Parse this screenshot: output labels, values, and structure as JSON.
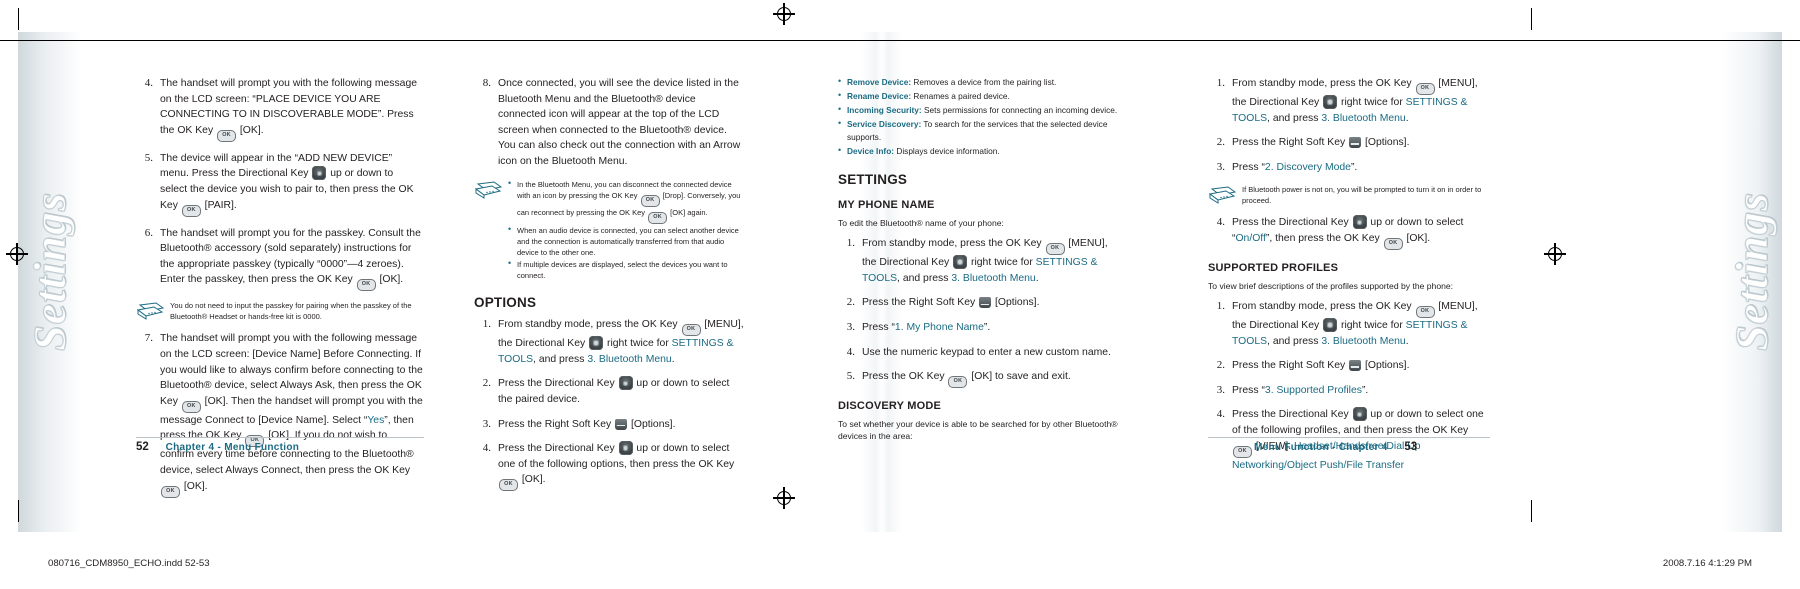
{
  "document": {
    "sidetab_left": "Settings",
    "sidetab_right": "Settings"
  },
  "footer": {
    "left_page_number": "52",
    "left_chapter": "Chapter 4 - Menu Function",
    "right_chapter": "Menu Function - Chapter 4",
    "right_page_number": "53"
  },
  "printbar": {
    "file": "080716_CDM8950_ECHO.indd   52-53",
    "timestamp": "2008.7.16   4:1:29 PM"
  },
  "keys": {
    "ok_label": "OK"
  },
  "column1": {
    "steps": [
      {
        "num": "4",
        "parts": [
          {
            "t": "The handset will prompt you with the following message on the LCD screen: “PLACE DEVICE YOU ARE CONNECTING TO IN DISCOVERABLE MODE”. Press the OK Key "
          },
          {
            "k": "ok"
          },
          {
            "t": " [OK]."
          }
        ]
      },
      {
        "num": "5",
        "parts": [
          {
            "t": "The device will appear in the “ADD NEW DEVICE” menu. Press the Directional Key "
          },
          {
            "k": "dir"
          },
          {
            "t": " up or down to select the device you wish to pair to, then press the OK Key "
          },
          {
            "k": "ok"
          },
          {
            "t": " [PAIR]."
          }
        ]
      },
      {
        "num": "6",
        "parts": [
          {
            "t": "The handset will prompt you for the passkey. Consult the Bluetooth® accessory (sold separately) instructions for the appropriate passkey (typically “0000”—4 zeroes). Enter the passkey, then press the OK Key "
          },
          {
            "k": "ok"
          },
          {
            "t": " [OK]."
          }
        ]
      }
    ],
    "note": "You do not need to input the passkey for pairing when the passkey of the Bluetooth® Headset or hands-free kit is 0000.",
    "step7": {
      "num": "7",
      "parts": [
        {
          "t": "The handset will prompt you with the following message on the LCD screen: [Device Name] Before Connecting. If you would like to always confirm before connecting to the Bluetooth® device, select Always Ask, then press the OK Key "
        },
        {
          "k": "ok"
        },
        {
          "t": " [OK]. Then the handset will prompt you with the message Connect to [Device Name]. Select “"
        },
        {
          "b": "Yes"
        },
        {
          "t": "”, then press the OK Key "
        },
        {
          "k": "ok"
        },
        {
          "t": " [OK]. If you do not wish to confirm every time before connecting to the Bluetooth® device, select Always Connect, then press the OK Key "
        },
        {
          "k": "ok"
        },
        {
          "t": " [OK]."
        }
      ]
    }
  },
  "column2": {
    "step8": {
      "num": "8",
      "text": "Once connected, you will see the device listed in the Bluetooth Menu and the Bluetooth® device connected icon will appear at the top of the LCD screen when connected to the Bluetooth® device.\nYou can also check out the connection with an Arrow icon on the Bluetooth Menu."
    },
    "notes": [
      [
        {
          "t": "In the Bluetooth Menu, you can disconnect the connected device with an icon by pressing the OK Key "
        },
        {
          "k": "ok"
        },
        {
          "t": " [Drop]. Conversely, you can reconnect by pressing the OK Key "
        },
        {
          "k": "ok"
        },
        {
          "t": " [OK] again."
        }
      ],
      [
        {
          "t": "When an audio device is connected, you can select another device and the connection is automatically transferred from that audio device to the other one."
        }
      ],
      [
        {
          "t": "If multiple devices are displayed, select the devices you want to connect."
        }
      ]
    ],
    "heading": "OPTIONS",
    "steps": [
      {
        "num": "1",
        "parts": [
          {
            "t": "From standby mode, press the OK Key "
          },
          {
            "k": "ok"
          },
          {
            "t": " [MENU], the Directional Key "
          },
          {
            "k": "dir"
          },
          {
            "t": " right twice for "
          },
          {
            "b": "SETTINGS & TOOLS"
          },
          {
            "t": ", and press "
          },
          {
            "b": "3. Bluetooth Menu"
          },
          {
            "t": "."
          }
        ]
      },
      {
        "num": "2",
        "parts": [
          {
            "t": "Press the Directional Key "
          },
          {
            "k": "dir"
          },
          {
            "t": " up or down to select the paired device."
          }
        ]
      },
      {
        "num": "3",
        "parts": [
          {
            "t": "Press the Right Soft Key "
          },
          {
            "k": "soft"
          },
          {
            "t": " [Options]."
          }
        ]
      },
      {
        "num": "4",
        "parts": [
          {
            "t": "Press the Directional Key "
          },
          {
            "k": "dir"
          },
          {
            "t": " up or down to select one of the following options, then press the OK Key "
          },
          {
            "k": "ok"
          },
          {
            "t": " [OK]."
          }
        ]
      }
    ]
  },
  "column3": {
    "definitions": [
      {
        "term": "Remove Device:",
        "desc": "Removes a device from the pairing list."
      },
      {
        "term": "Rename Device:",
        "desc": "Renames a paired device."
      },
      {
        "term": "Incoming Security:",
        "desc": "Sets permissions for connecting an incoming device."
      },
      {
        "term": "Service Discovery:",
        "desc": "To search for the services that the selected device supports."
      },
      {
        "term": "Device Info:",
        "desc": "Displays device information."
      }
    ],
    "heading": "SETTINGS",
    "subheading": "MY PHONE NAME",
    "lead": "To edit the Bluetooth® name of your phone:",
    "steps": [
      {
        "num": "1",
        "parts": [
          {
            "t": "From standby mode, press the OK Key "
          },
          {
            "k": "ok"
          },
          {
            "t": " [MENU], the Directional Key "
          },
          {
            "k": "dir"
          },
          {
            "t": " right twice for "
          },
          {
            "b": "SETTINGS & TOOLS"
          },
          {
            "t": ", and press "
          },
          {
            "b": "3. Bluetooth Menu"
          },
          {
            "t": "."
          }
        ]
      },
      {
        "num": "2",
        "parts": [
          {
            "t": "Press the Right Soft Key "
          },
          {
            "k": "soft"
          },
          {
            "t": " [Options]."
          }
        ]
      },
      {
        "num": "3",
        "parts": [
          {
            "t": "Press “"
          },
          {
            "b": "1. My Phone Name"
          },
          {
            "t": "”."
          }
        ]
      },
      {
        "num": "4",
        "parts": [
          {
            "t": "Use the numeric keypad to enter a new custom name."
          }
        ]
      },
      {
        "num": "5",
        "parts": [
          {
            "t": "Press the OK Key "
          },
          {
            "k": "ok"
          },
          {
            "t": " [OK] to save and exit."
          }
        ]
      }
    ],
    "subheading2": "DISCOVERY MODE",
    "lead2": "To set whether your device is able to be searched for by other Bluetooth® devices in the area:"
  },
  "column4": {
    "steps": [
      {
        "num": "1",
        "parts": [
          {
            "t": "From standby mode, press the OK Key "
          },
          {
            "k": "ok"
          },
          {
            "t": " [MENU], the Directional Key "
          },
          {
            "k": "dir"
          },
          {
            "t": " right twice for "
          },
          {
            "b": "SETTINGS & TOOLS"
          },
          {
            "t": ", and press "
          },
          {
            "b": "3. Bluetooth Menu"
          },
          {
            "t": "."
          }
        ]
      },
      {
        "num": "2",
        "parts": [
          {
            "t": "Press the Right Soft Key "
          },
          {
            "k": "soft"
          },
          {
            "t": " [Options]."
          }
        ]
      },
      {
        "num": "3",
        "parts": [
          {
            "t": "Press “"
          },
          {
            "b": "2. Discovery Mode"
          },
          {
            "t": "”."
          }
        ]
      }
    ],
    "note": "If Bluetooth power is not on, you will be prompted to turn it on in order to proceed.",
    "step4": {
      "num": "4",
      "parts": [
        {
          "t": "Press the Directional Key "
        },
        {
          "k": "dir"
        },
        {
          "t": " up or down to select “"
        },
        {
          "b": "On/Off"
        },
        {
          "t": "”, then press the OK Key "
        },
        {
          "k": "ok"
        },
        {
          "t": " [OK]."
        }
      ]
    },
    "subheading": "SUPPORTED PROFILES",
    "lead": "To view brief descriptions of the profiles supported by the phone:",
    "steps2": [
      {
        "num": "1",
        "parts": [
          {
            "t": "From standby mode, press the OK Key "
          },
          {
            "k": "ok"
          },
          {
            "t": " [MENU], the Directional Key "
          },
          {
            "k": "dir"
          },
          {
            "t": " right twice for "
          },
          {
            "b": "SETTINGS & TOOLS"
          },
          {
            "t": ", and press "
          },
          {
            "b": "3. Bluetooth Menu"
          },
          {
            "t": "."
          }
        ]
      },
      {
        "num": "2",
        "parts": [
          {
            "t": "Press the Right Soft Key "
          },
          {
            "k": "soft"
          },
          {
            "t": " [Options]."
          }
        ]
      },
      {
        "num": "3",
        "parts": [
          {
            "t": "Press “"
          },
          {
            "b": "3. Supported Profiles"
          },
          {
            "t": "”."
          }
        ]
      },
      {
        "num": "4",
        "parts": [
          {
            "t": "Press the Directional Key "
          },
          {
            "k": "dir"
          },
          {
            "t": " up or down to select one of the following profiles, and then press the OK Key "
          },
          {
            "k": "ok"
          },
          {
            "t": " [VIEW]. "
          },
          {
            "b": "Headset/Handsfree/Dial Up Networking/Object Push/File Transfer"
          }
        ]
      }
    ]
  },
  "colors": {
    "accent": "#1b6b83",
    "text": "#231f20",
    "page_edge": "#cfd8dc"
  }
}
